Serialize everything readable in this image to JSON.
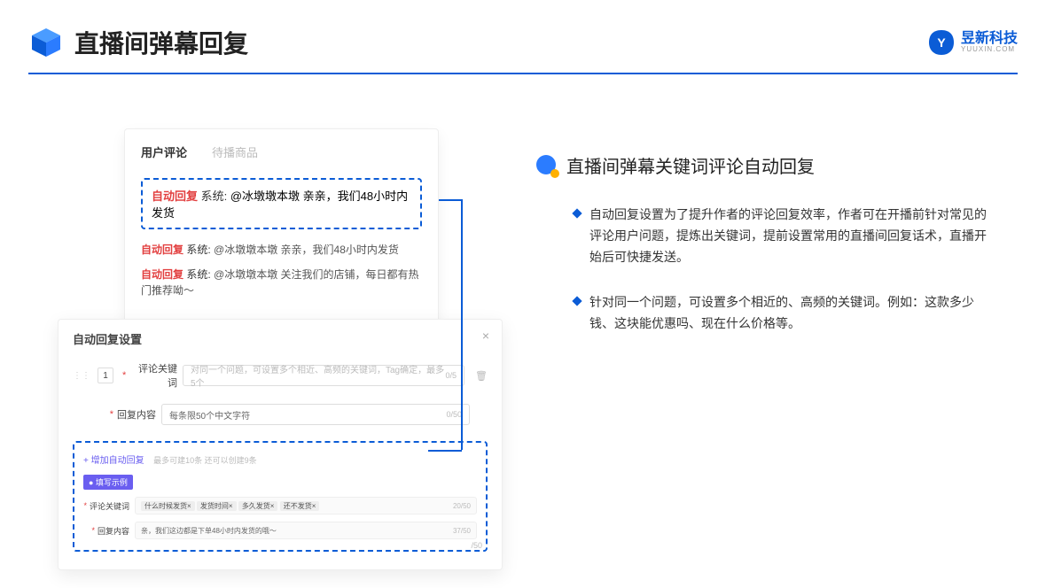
{
  "header": {
    "title": "直播间弹幕回复",
    "brand_cn": "昱新科技",
    "brand_en": "YUUXIN.COM"
  },
  "comment_panel": {
    "tab_active": "用户评论",
    "tab_other": "待播商品",
    "highlight_auto": "自动回复",
    "highlight_sys": " 系统: ",
    "highlight_text": "@冰墩墩本墩 亲亲，我们48小时内发货",
    "item1_auto": "自动回复",
    "item1_sys": " 系统: ",
    "item1_text": "@冰墩墩本墩 亲亲，我们48小时内发货",
    "item2_auto": "自动回复",
    "item2_sys": " 系统: ",
    "item2_text": "@冰墩墩本墩 关注我们的店铺，每日都有热门推荐呦～"
  },
  "settings": {
    "title": "自动回复设置",
    "close": "×",
    "seq": "1",
    "keyword_label": "评论关键词",
    "keyword_placeholder": "对同一个问题，可设置多个相近、高频的关键词，Tag确定，最多5个",
    "keyword_count": "0/5",
    "content_label": "回复内容",
    "content_placeholder": "每条限50个中文字符",
    "content_count": "0/50",
    "add_link": "+ 增加自动回复",
    "add_hint": "最多可建10条 还可以创建9条",
    "example_badge": "● 填写示例",
    "ex_keyword_label": "评论关键词",
    "ex_tag1": "什么时候发货×",
    "ex_tag2": "发货时间×",
    "ex_tag3": "多久发货×",
    "ex_tag4": "还不发货×",
    "ex_keyword_count": "20/50",
    "ex_content_label": "回复内容",
    "ex_content_text": "亲，我们这边都是下单48小时内发货的哦～",
    "ex_content_count": "37/50",
    "trailing": "/50"
  },
  "right": {
    "section_title": "直播间弹幕关键词评论自动回复",
    "bullet1": "自动回复设置为了提升作者的评论回复效率，作者可在开播前针对常见的评论用户问题，提炼出关键词，提前设置常用的直播间回复话术，直播开始后可快捷发送。",
    "bullet2": "针对同一个问题，可设置多个相近的、高频的关键词。例如：这款多少钱、这块能优惠吗、现在什么价格等。"
  }
}
